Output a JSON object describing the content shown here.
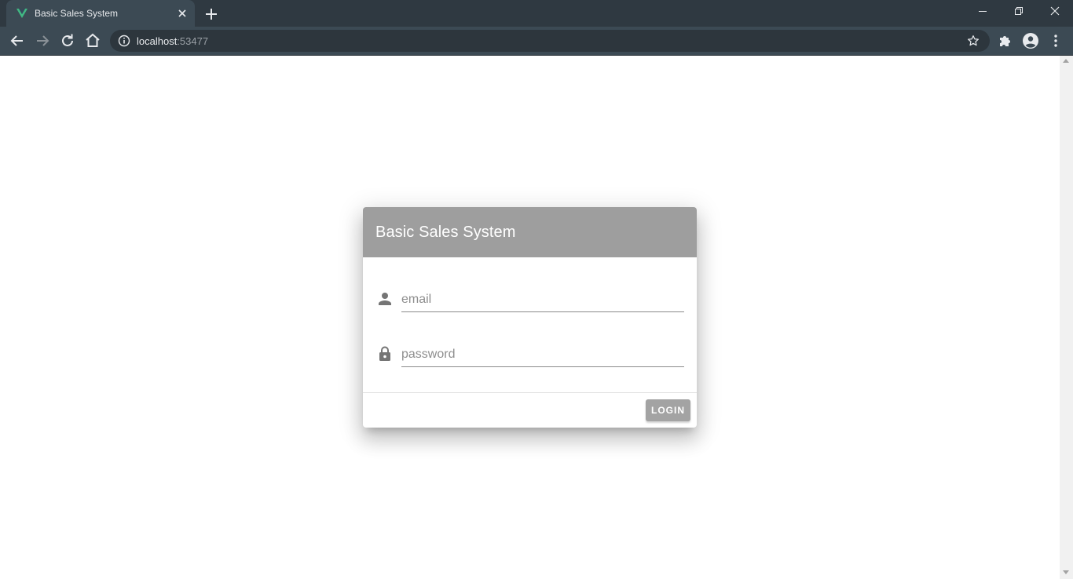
{
  "browser": {
    "tab": {
      "title": "Basic Sales System",
      "favicon": "vue-logo-icon"
    },
    "address": {
      "host": "localhost",
      "port": ":53477"
    },
    "colors": {
      "tabstrip": "#2f3941",
      "toolbar": "#3c4a54",
      "favicon": "#41b883"
    }
  },
  "login": {
    "title": "Basic Sales System",
    "email": {
      "placeholder": "email",
      "value": "",
      "icon": "person-icon"
    },
    "password": {
      "placeholder": "password",
      "value": "",
      "icon": "lock-icon"
    },
    "submit_label": "LOGIN",
    "colors": {
      "header": "#9e9e9e",
      "button": "#a3a3a3"
    }
  }
}
